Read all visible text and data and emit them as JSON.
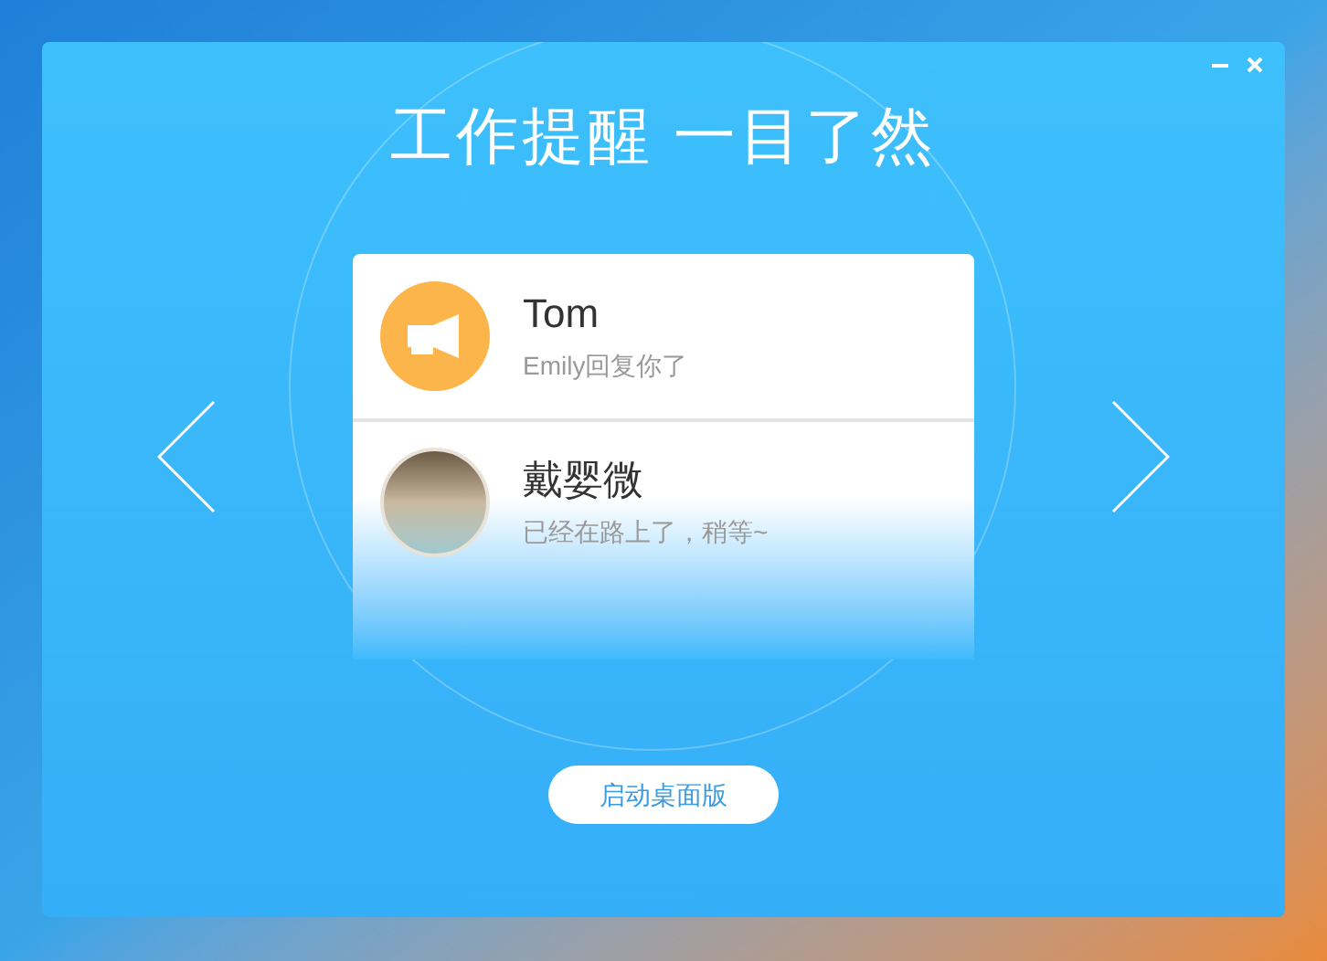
{
  "window": {
    "title": "工作提醒 一目了然"
  },
  "messages": [
    {
      "name": "Tom",
      "text": "Emily回复你了",
      "kind": "icon"
    },
    {
      "name": "戴婴微",
      "text": "已经在路上了，稍等~",
      "kind": "photo"
    }
  ],
  "button": "启动桌面版"
}
